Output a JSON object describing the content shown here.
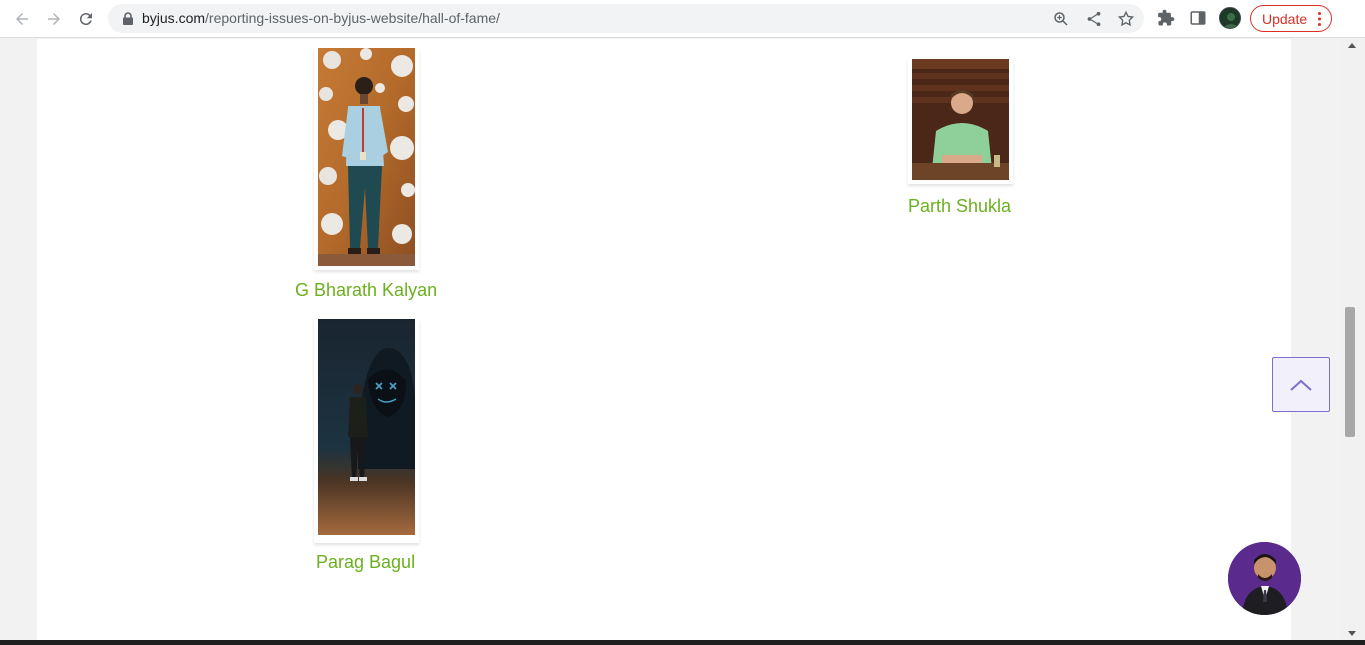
{
  "browser": {
    "url_host": "byjus.com",
    "url_path": "/reporting-issues-on-byjus-website/hall-of-fame/",
    "update_label": "Update"
  },
  "hall_of_fame": {
    "people": [
      {
        "name": "G Bharath Kalyan"
      },
      {
        "name": "Parth Shukla"
      },
      {
        "name": "Parag Bagul"
      }
    ]
  },
  "colors": {
    "name_link": "#6bb01f",
    "accent_purple": "#7b6fcf",
    "update_red": "#d93025"
  }
}
